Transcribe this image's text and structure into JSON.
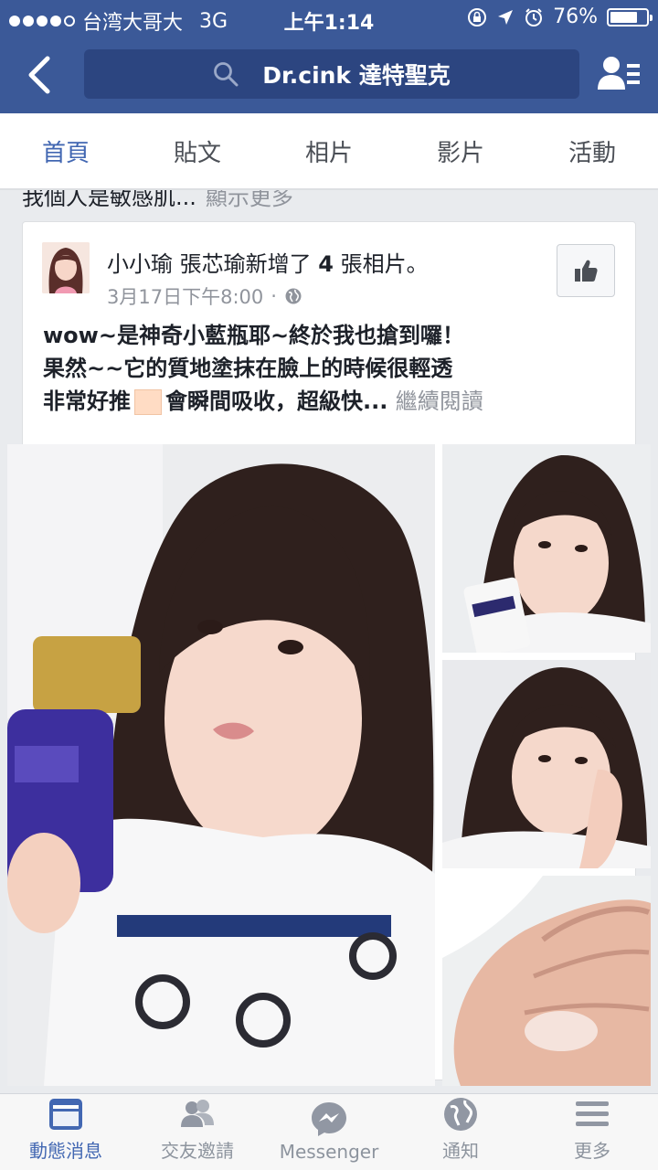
{
  "status_bar": {
    "carrier": "台湾大哥大",
    "network": "3G",
    "time": "上午1:14",
    "battery_percent": "76%",
    "battery_level": 0.76
  },
  "nav": {
    "back_icon": "chevron-left-icon",
    "search_text": "Dr.cink 達特聖克",
    "search_icon": "search-icon",
    "friends_icon": "friends-list-icon"
  },
  "tabs": [
    {
      "label": "首頁",
      "active": true
    },
    {
      "label": "貼文",
      "active": false
    },
    {
      "label": "相片",
      "active": false
    },
    {
      "label": "影片",
      "active": false
    },
    {
      "label": "活動",
      "active": false
    }
  ],
  "previous_post": {
    "text": "我個人是敏感肌...",
    "more": "顯示更多"
  },
  "post": {
    "author": "小小瑜 張芯瑜",
    "action": "新增了",
    "count": "4",
    "unit": "張相片。",
    "timestamp": "3月17日下午8:00",
    "separator": "·",
    "privacy_icon": "globe-icon",
    "text_line1": "wow~是神奇小藍瓶耶~終於我也搶到囉！",
    "text_line2": "果然~~它的質地塗抹在臉上的時候很輕透",
    "text_line3a": "非常好推",
    "text_line3b": "會瞬間吸收，超級快...",
    "read_more": "繼續閱讀",
    "like_icon": "thumbs-up-icon",
    "photos": [
      {
        "name": "selfie-with-serum-bottle"
      },
      {
        "name": "selfie-with-dr-cink-box"
      },
      {
        "name": "selfie-hand-on-cheek"
      },
      {
        "name": "serum-on-palm"
      }
    ]
  },
  "bottom_bar": [
    {
      "label": "動態消息",
      "icon": "news-feed-icon",
      "active": true
    },
    {
      "label": "交友邀請",
      "icon": "friend-requests-icon",
      "active": false
    },
    {
      "label": "Messenger",
      "icon": "messenger-icon",
      "active": false
    },
    {
      "label": "通知",
      "icon": "notifications-globe-icon",
      "active": false
    },
    {
      "label": "更多",
      "icon": "menu-icon",
      "active": false
    }
  ],
  "colors": {
    "brand_blue": "#3b5998",
    "active_tab": "#4267b2",
    "muted_text": "#90949c"
  }
}
